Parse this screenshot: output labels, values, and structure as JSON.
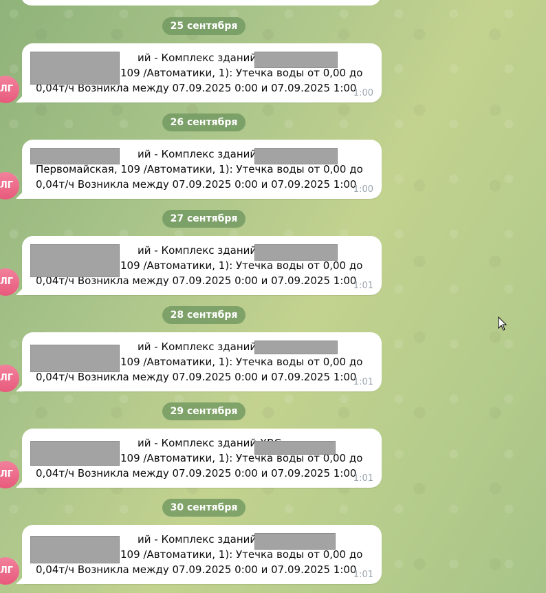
{
  "avatar": {
    "initials": "ЛГ",
    "color": "#ec6a89"
  },
  "message": {
    "line1_tail": "ий - Комплекс зданий ХВС",
    "line2_tail": "109 /Автоматики, 1): Утечка воды от 0,00 до",
    "line2_full_prefix": "Первомайская,",
    "line3": "0,04т/ч Возникла между 07.09.2025 0:00 и 07.09.2025 1:00"
  },
  "messages": [
    {
      "date": "25 сентября",
      "time": "1:00"
    },
    {
      "date": "26 сентября",
      "time": "1:00"
    },
    {
      "date": "27 сентября",
      "time": "1:01"
    },
    {
      "date": "28 сентября",
      "time": "1:01"
    },
    {
      "date": "29 сентября",
      "time": "1:01"
    },
    {
      "date": "30 сентября",
      "time": "1:01"
    }
  ],
  "colors": {
    "date_pill": "#6e965f",
    "bubble": "#ffffff",
    "time_text": "#9aa4ad",
    "redaction": "#a3a3a3"
  }
}
